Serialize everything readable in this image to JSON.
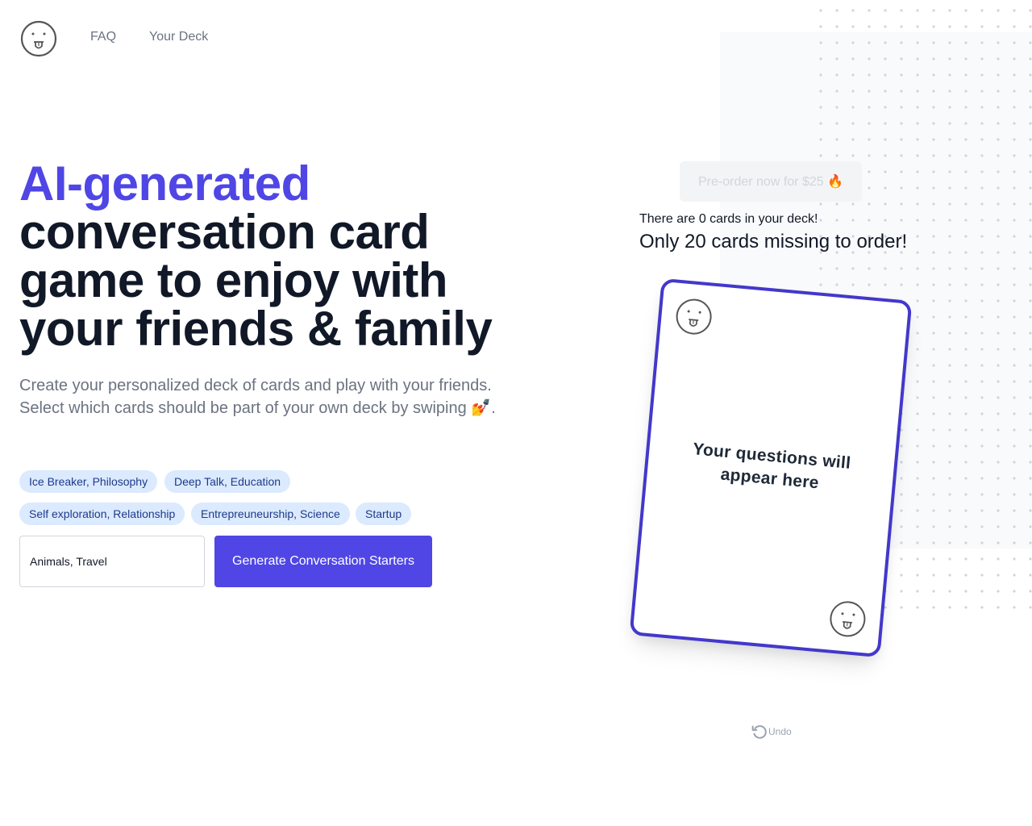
{
  "header": {
    "logo_icon": "tongue-out-face-icon",
    "nav": [
      {
        "label": "FAQ"
      },
      {
        "label": "Your Deck"
      }
    ]
  },
  "hero": {
    "title_accent": "AI-generated",
    "title_rest": "conversation card game to enjoy with your friends & family",
    "subtitle_line1": "Create your personalized deck of cards and play with your friends.",
    "subtitle_line2": "Select which cards should be part of your own deck by swiping 💅.",
    "accent_color": "#4f46e5"
  },
  "tags": [
    {
      "label": "Ice Breaker, Philosophy"
    },
    {
      "label": "Deep Talk, Education"
    },
    {
      "label": "Self exploration, Relationship"
    },
    {
      "label": "Entrepreuneurship, Science"
    },
    {
      "label": "Startup"
    }
  ],
  "generator": {
    "input_value": "Animals, Travel",
    "button_label": "Generate Conversation Starters",
    "button_color": "#4f46e5"
  },
  "deck": {
    "preorder_label": "Pre-order now for $25 🔥",
    "preorder_disabled": true,
    "count_text": "There are 0 cards in your deck!",
    "missing_text": "Only 20 cards missing to order!",
    "card_count": 0,
    "cards_missing": 20
  },
  "card": {
    "placeholder_text": "Your questions will appear here",
    "border_color": "#4338ca",
    "corner_icon": "tongue-out-face-icon"
  },
  "undo": {
    "label": "Undo",
    "icon": "undo-arrow-icon"
  }
}
